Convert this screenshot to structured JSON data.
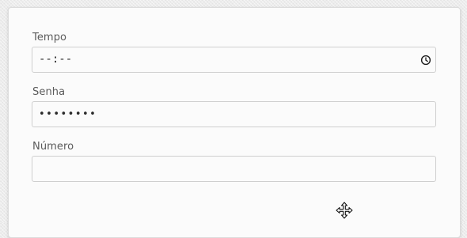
{
  "form": {
    "fields": [
      {
        "label": "Tempo",
        "type": "time",
        "value": "--:--",
        "icon": "clock-icon"
      },
      {
        "label": "Senha",
        "type": "password",
        "value": "••••••••"
      },
      {
        "label": "Número",
        "type": "number",
        "value": ""
      }
    ]
  },
  "cursor": {
    "icon": "move-cursor-icon"
  },
  "colors": {
    "background": "#ececec",
    "card": "#fbfbfb",
    "border": "#cfcfcf",
    "label": "#5b5b5b",
    "text": "#2a2a2a"
  }
}
